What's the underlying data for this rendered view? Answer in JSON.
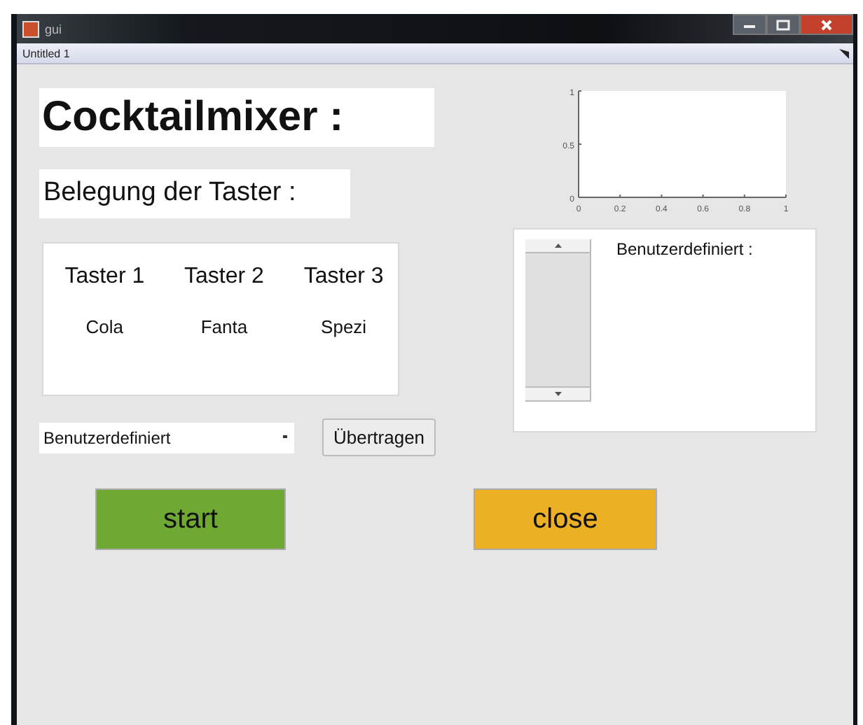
{
  "window": {
    "title": "gui"
  },
  "document_tab": {
    "label": "Untitled 1"
  },
  "heading": "Cocktailmixer :",
  "subheading": "Belegung der Taster :",
  "buttons_panel": {
    "columns": [
      {
        "label": "Taster 1",
        "drink": "Cola"
      },
      {
        "label": "Taster 2",
        "drink": "Fanta"
      },
      {
        "label": "Taster 3",
        "drink": "Spezi"
      }
    ]
  },
  "preset_dropdown": {
    "value": "Benutzerdefiniert"
  },
  "transfer_button": "Übertragen",
  "axes": {
    "chart_data": {
      "type": "line",
      "xlim": [
        0,
        1
      ],
      "ylim": [
        0,
        1
      ],
      "xticks": [
        0,
        0.2,
        0.4,
        0.6,
        0.8,
        1
      ],
      "yticks": [
        0,
        0.5,
        1
      ]
    }
  },
  "custom_panel": {
    "label": "Benutzerdefiniert :"
  },
  "action_buttons": [
    {
      "label": "start",
      "color": "#6fa833"
    },
    {
      "label": "close",
      "color": "#ecb025"
    }
  ]
}
